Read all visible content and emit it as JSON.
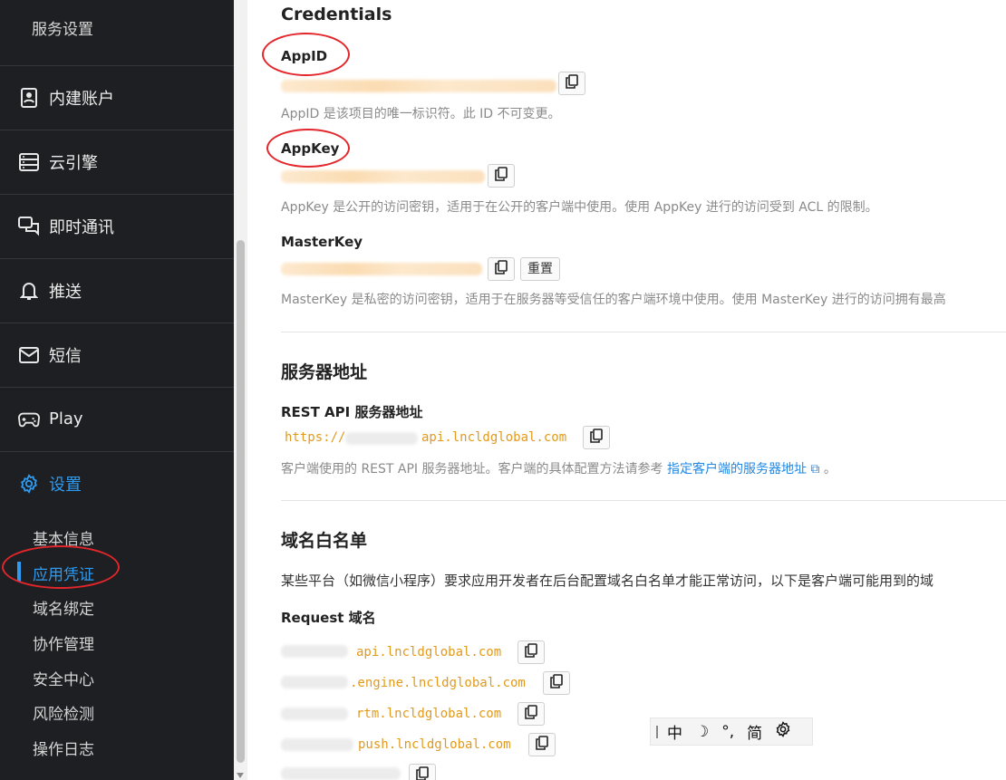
{
  "sidebar": {
    "top_label": "服务设置",
    "items": [
      {
        "label": "内建账户",
        "icon": "contact-card-icon"
      },
      {
        "label": "云引擎",
        "icon": "server-icon"
      },
      {
        "label": "即时通讯",
        "icon": "chat-bubbles-icon"
      },
      {
        "label": "推送",
        "icon": "bell-icon"
      },
      {
        "label": "短信",
        "icon": "envelope-icon"
      },
      {
        "label": "Play",
        "icon": "gamepad-icon"
      },
      {
        "label": "设置",
        "icon": "gear-icon",
        "active": true
      }
    ],
    "sub_items": [
      {
        "label": "基本信息"
      },
      {
        "label": "应用凭证",
        "active": true
      },
      {
        "label": "域名绑定"
      },
      {
        "label": "协作管理"
      },
      {
        "label": "安全中心"
      },
      {
        "label": "风险检测"
      },
      {
        "label": "操作日志"
      }
    ]
  },
  "credentials": {
    "heading": "Credentials",
    "appid": {
      "label": "AppID",
      "description": "AppID 是该项目的唯一标识符。此 ID 不可变更。"
    },
    "appkey": {
      "label": "AppKey",
      "description": "AppKey 是公开的访问密钥，适用于在公开的客户端中使用。使用 AppKey 进行的访问受到 ACL 的限制。"
    },
    "masterkey": {
      "label": "MasterKey",
      "reset_label": "重置",
      "description": "MasterKey 是私密的访问密钥，适用于在服务器等受信任的客户端环境中使用。使用 MasterKey 进行的访问拥有最高"
    }
  },
  "server": {
    "heading": "服务器地址",
    "rest_label": "REST API 服务器地址",
    "rest_prefix": "https://",
    "rest_suffix": "api.lncldglobal.com",
    "description_prefix": "客户端使用的 REST API 服务器地址。客户端的具体配置方法请参考 ",
    "link_text": "指定客户端的服务器地址",
    "description_suffix": " 。"
  },
  "whitelist": {
    "heading": "域名白名单",
    "description": "某些平台（如微信小程序）要求应用开发者在后台配置域名白名单才能正常访问，以下是客户端可能用到的域",
    "request_label": "Request 域名",
    "domains": [
      "api.lncldglobal.com",
      ".engine.lncldglobal.com",
      "rtm.lncldglobal.com",
      "push.lncldglobal.com"
    ]
  },
  "ime_toolbar": {
    "lang": "中",
    "moon": "☽",
    "punct": "°,",
    "charset": "简"
  },
  "colors": {
    "sidebar_bg": "#1d1f22",
    "accent": "#2f9bf0",
    "domain_text": "#e29a1c",
    "annotation_red": "#e3262b"
  }
}
